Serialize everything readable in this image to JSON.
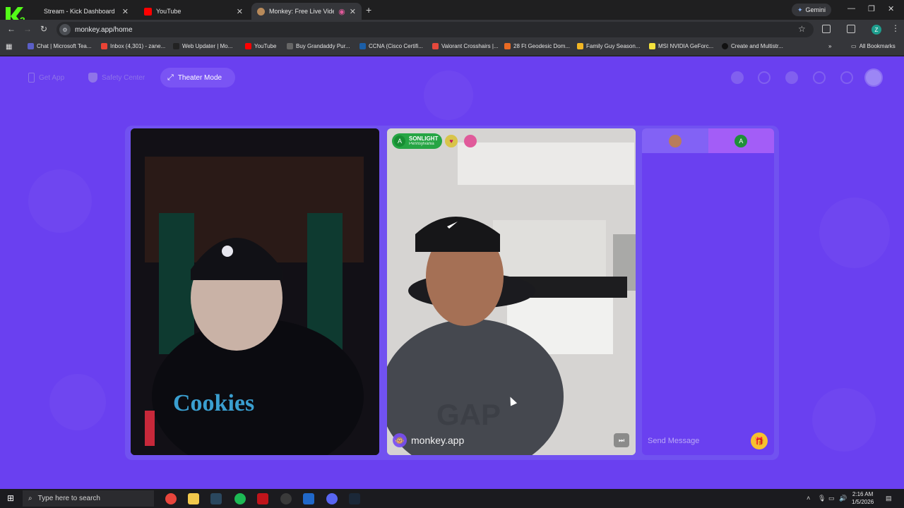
{
  "browser": {
    "tabs": [
      {
        "label": "Stream - Kick Dashboard",
        "active": false,
        "icon": "kick-icon"
      },
      {
        "label": "YouTube",
        "active": false,
        "icon": "youtube-icon"
      },
      {
        "label": "Monkey: Free Live Video Ch",
        "active": true,
        "icon": "monkey-icon"
      }
    ],
    "gemini_label": "Gemini",
    "url": "monkey.app/home",
    "profile_initial": "Z",
    "bookmarks": [
      {
        "label": "Chat | Microsoft Tea...",
        "color": "#5b5fc7"
      },
      {
        "label": "Inbox (4,301) - zane...",
        "color": "#ea4335"
      },
      {
        "label": "Web Updater | Mo...",
        "color": "#222222"
      },
      {
        "label": "YouTube",
        "color": "#ff0000"
      },
      {
        "label": "Buy Grandaddy Pur...",
        "color": "#666666"
      },
      {
        "label": "CCNA (Cisco Certifi...",
        "color": "#1b5fa8"
      },
      {
        "label": "Valorant Crosshairs |...",
        "color": "#e5483c"
      },
      {
        "label": "28 Ft Geodesic Dom...",
        "color": "#e96a23"
      },
      {
        "label": "Family Guy Season...",
        "color": "#f2b623"
      },
      {
        "label": "MSI NVIDIA GeForc...",
        "color": "#f4e23c"
      },
      {
        "label": "Create and Multistr...",
        "color": "#111111"
      }
    ],
    "all_bookmarks": "All Bookmarks"
  },
  "app": {
    "nav": {
      "get_app": "Get App",
      "safety_center": "Safety Center",
      "theater_mode": "Theater Mode"
    },
    "remote_user": {
      "name": "SONLIGHT",
      "location": "Pennsylvania",
      "avatar_initial": "A"
    },
    "watermark": "monkey.app",
    "chat": {
      "tab2_initial": "A",
      "placeholder": "Send Message"
    }
  },
  "taskbar": {
    "search_placeholder": "Type here to search",
    "time": "2:16 AM",
    "date": "1/5/2026"
  }
}
